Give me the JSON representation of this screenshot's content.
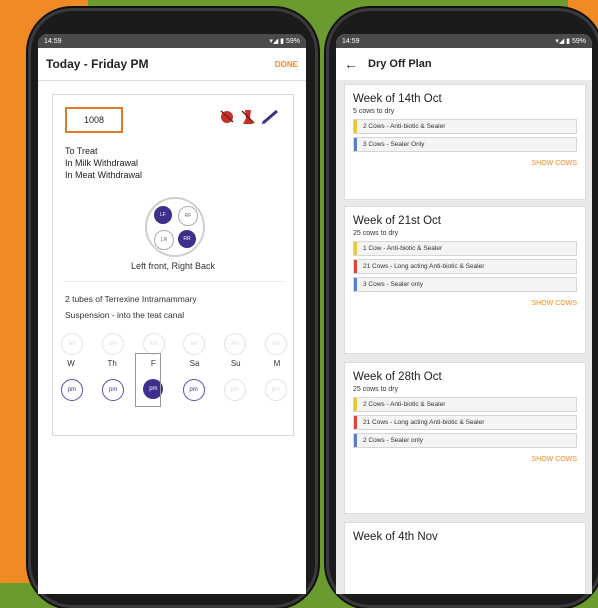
{
  "colors": {
    "brand": "#f08a24",
    "accent": "#3d2f8b",
    "yellow": "#e7c93a",
    "red": "#d9483b",
    "blue": "#5b7fc6"
  },
  "left": {
    "status": {
      "time": "14:59",
      "right": "▾◢ ▮ 59%"
    },
    "title": "Today - Friday PM",
    "done": "DONE",
    "cow_id": "1008",
    "status_lines": [
      "To Treat",
      "In Milk Withdrawal",
      "In Meat Withdrawal"
    ],
    "quarters": {
      "lf": "LF",
      "rf": "RF",
      "lr": "LR",
      "rr": "RR",
      "label": "Left front, Right Back"
    },
    "treatment_line1": "2 tubes of Terrexine Intramammary",
    "treatment_line2": "Suspension - into the teat canal",
    "am_label": "am",
    "pm_label": "pm",
    "days": [
      "W",
      "Th",
      "F",
      "Sa",
      "Su",
      "M"
    ]
  },
  "right": {
    "status": {
      "time": "14:59",
      "right": "▾◢ ▮ 59%"
    },
    "title": "Dry Off Plan",
    "weeks": [
      {
        "title": "Week of 14th Oct",
        "sub": "5 cows to dry",
        "rows": [
          {
            "color": "#e7c93a",
            "text": "2 Cows - Anti-biotic & Sealer"
          },
          {
            "color": "#5b7fc6",
            "text": "3 Cows - Sealer Only"
          }
        ],
        "action": "SHOW COWS"
      },
      {
        "title": "Week of 21st Oct",
        "sub": "25 cows to dry",
        "rows": [
          {
            "color": "#e7c93a",
            "text": "1 Cow - Anti-biotic & Sealer"
          },
          {
            "color": "#d9483b",
            "text": "21 Cows - Long acting Anti-biotic & Sealer"
          },
          {
            "color": "#5b7fc6",
            "text": "3 Cows - Sealer only"
          }
        ],
        "action": "SHOW COWS"
      },
      {
        "title": "Week of 28th Oct",
        "sub": "25 cows to dry",
        "rows": [
          {
            "color": "#e7c93a",
            "text": "2 Cows - Anti-biotic & Sealer"
          },
          {
            "color": "#d9483b",
            "text": "21 Cows - Long acting Anti-biotic & Sealer"
          },
          {
            "color": "#5b7fc6",
            "text": "2 Cows - Sealer only"
          }
        ],
        "action": "SHOW COWS"
      },
      {
        "title": "Week of 4th Nov"
      }
    ]
  }
}
